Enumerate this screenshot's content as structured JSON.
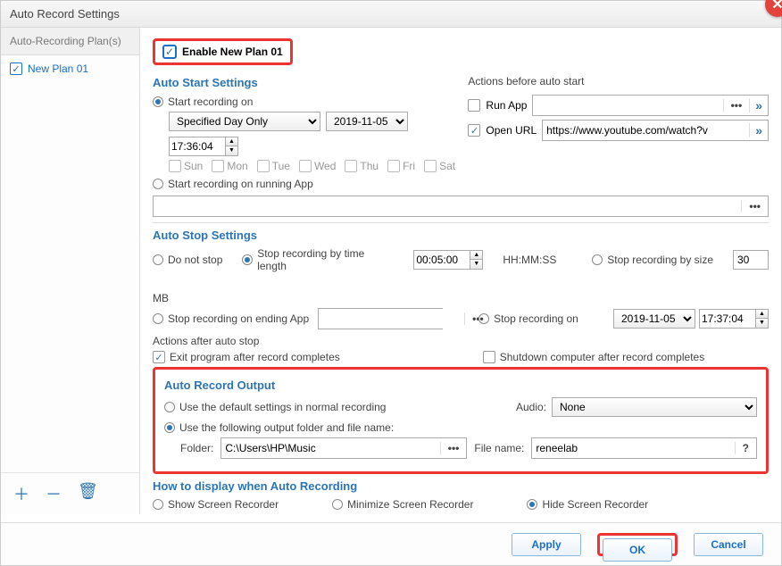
{
  "window": {
    "title": "Auto Record Settings"
  },
  "sidebar": {
    "tab_label": "Auto-Recording Plan(s)",
    "plan_label": "New Plan 01"
  },
  "enable_plan": {
    "label": "Enable New Plan 01"
  },
  "auto_start": {
    "title": "Auto Start Settings",
    "start_on_label": "Start recording on",
    "schedule_select": "Specified Day Only",
    "date": "2019-11-05",
    "time": "17:36:04",
    "days": {
      "sun": "Sun",
      "mon": "Mon",
      "tue": "Tue",
      "wed": "Wed",
      "thu": "Thu",
      "fri": "Fri",
      "sat": "Sat"
    },
    "start_app_label": "Start recording on running App",
    "actions_title": "Actions before auto start",
    "run_app_label": "Run App",
    "open_url_label": "Open URL",
    "open_url_value": "https://www.youtube.com/watch?v"
  },
  "auto_stop": {
    "title": "Auto Stop Settings",
    "no_stop_label": "Do not stop",
    "by_time_label": "Stop recording by time length",
    "by_time_value": "00:05:00",
    "hhmmss": "HH:MM:SS",
    "by_size_label": "Stop recording by size",
    "by_size_value": "30",
    "mb": "MB",
    "ending_app_label": "Stop recording on ending App",
    "stop_on_label": "Stop recording on",
    "stop_date": "2019-11-05",
    "stop_time": "17:37:04",
    "actions_title": "Actions after auto stop",
    "exit_label": "Exit program after record completes",
    "shutdown_label": "Shutdown computer after record completes"
  },
  "output": {
    "title": "Auto Record Output",
    "default_label": "Use the default settings in normal recording",
    "custom_label": "Use the following output folder and file name:",
    "audio_label": "Audio:",
    "audio_value": "None",
    "folder_label": "Folder:",
    "folder_value": "C:\\Users\\HP\\Music",
    "filename_label": "File name:",
    "filename_value": "reneelab"
  },
  "display": {
    "title": "How to display when Auto Recording",
    "show_label": "Show Screen Recorder",
    "min_label": "Minimize Screen Recorder",
    "hide_label": "Hide Screen Recorder"
  },
  "buttons": {
    "apply": "Apply",
    "ok": "OK",
    "cancel": "Cancel"
  }
}
